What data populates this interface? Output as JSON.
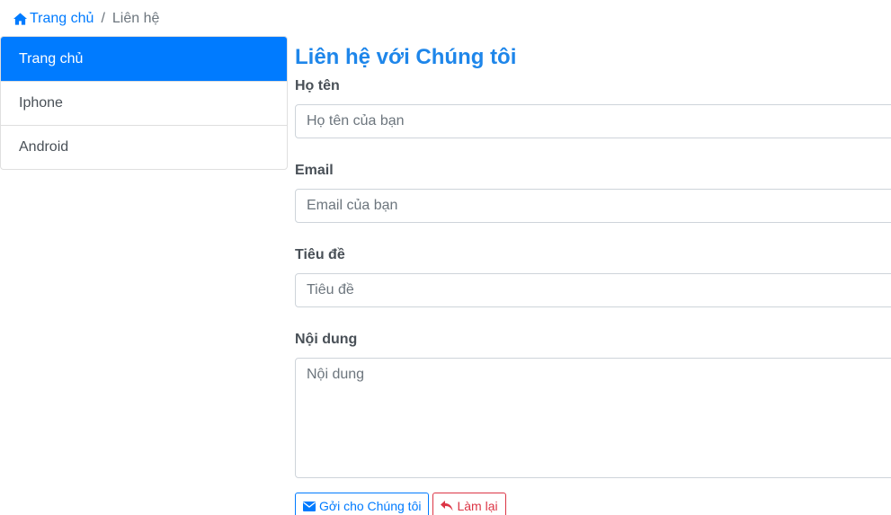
{
  "breadcrumb": {
    "home_label": "Trang chủ",
    "separator": "/",
    "current_label": "Liên hệ"
  },
  "sidebar": {
    "items": [
      {
        "label": "Trang chủ",
        "active": true
      },
      {
        "label": "Iphone",
        "active": false
      },
      {
        "label": "Android",
        "active": false
      }
    ]
  },
  "form": {
    "title": "Liên hệ với Chúng tôi",
    "name": {
      "label": "Họ tên",
      "placeholder": "Họ tên của bạn",
      "value": ""
    },
    "email": {
      "label": "Email",
      "placeholder": "Email của bạn",
      "value": ""
    },
    "subject": {
      "label": "Tiêu đề",
      "placeholder": "Tiêu đề",
      "value": ""
    },
    "message": {
      "label": "Nội dung",
      "placeholder": "Nội dung",
      "value": ""
    },
    "submit_label": "Gởi cho Chúng tôi",
    "reset_label": "Làm lại"
  },
  "colors": {
    "primary": "#007bff",
    "title": "#1e86ea",
    "danger": "#dc3545"
  },
  "icons": {
    "home": "home-icon",
    "submit": "envelope-icon",
    "reset": "undo-arrow-icon"
  }
}
